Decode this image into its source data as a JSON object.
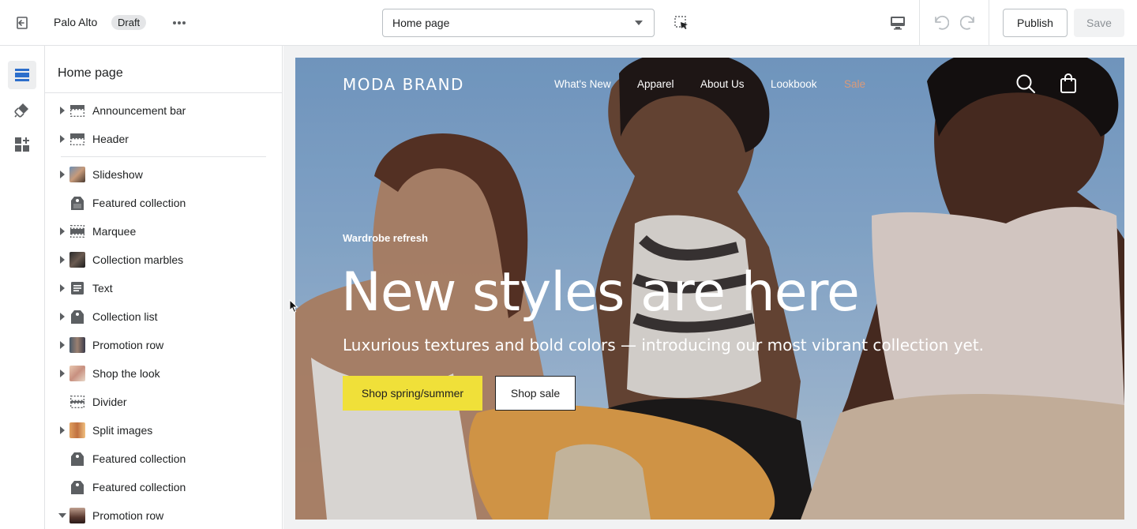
{
  "topbar": {
    "theme_name": "Palo Alto",
    "status_badge": "Draft",
    "page_select_value": "Home page",
    "publish_label": "Publish",
    "save_label": "Save"
  },
  "sidebar": {
    "title": "Home page",
    "header_sections": [
      {
        "label": "Announcement bar",
        "icon": "layout-bar-icon",
        "expandable": true
      },
      {
        "label": "Header",
        "icon": "layout-header-icon",
        "expandable": true
      }
    ],
    "sections": [
      {
        "label": "Slideshow",
        "icon": "image-thumbnail",
        "expandable": true
      },
      {
        "label": "Featured collection",
        "icon": "tag-icon",
        "expandable": false
      },
      {
        "label": "Marquee",
        "icon": "layout-bar-icon",
        "expandable": true
      },
      {
        "label": "Collection marbles",
        "icon": "image-thumbnail",
        "expandable": true
      },
      {
        "label": "Text",
        "icon": "text-icon",
        "expandable": true
      },
      {
        "label": "Collection list",
        "icon": "tag-icon",
        "expandable": true
      },
      {
        "label": "Promotion row",
        "icon": "image-thumbnail",
        "expandable": true
      },
      {
        "label": "Shop the look",
        "icon": "image-thumbnail",
        "expandable": true
      },
      {
        "label": "Divider",
        "icon": "layout-bar-icon",
        "expandable": false
      },
      {
        "label": "Split images",
        "icon": "image-thumbnail",
        "expandable": true
      },
      {
        "label": "Featured collection",
        "icon": "tag-icon",
        "expandable": false
      },
      {
        "label": "Featured collection",
        "icon": "tag-icon",
        "expandable": false
      },
      {
        "label": "Promotion row",
        "icon": "image-thumbnail",
        "expandable": true,
        "expanded": true
      }
    ]
  },
  "preview": {
    "brand": "MODA BRAND",
    "nav": [
      "What's New",
      "Apparel",
      "About Us",
      "Lookbook",
      "Sale"
    ],
    "eyebrow": "Wardrobe refresh",
    "title": "New styles are here",
    "subtitle": "Luxurious textures and bold colors — introducing our most vibrant collection yet.",
    "primary_button": "Shop spring/summer",
    "secondary_button": "Shop sale"
  },
  "colors": {
    "sale_link": "#d99a7a",
    "primary_button": "#f0e039",
    "rail_active": "#2c6ecb"
  }
}
